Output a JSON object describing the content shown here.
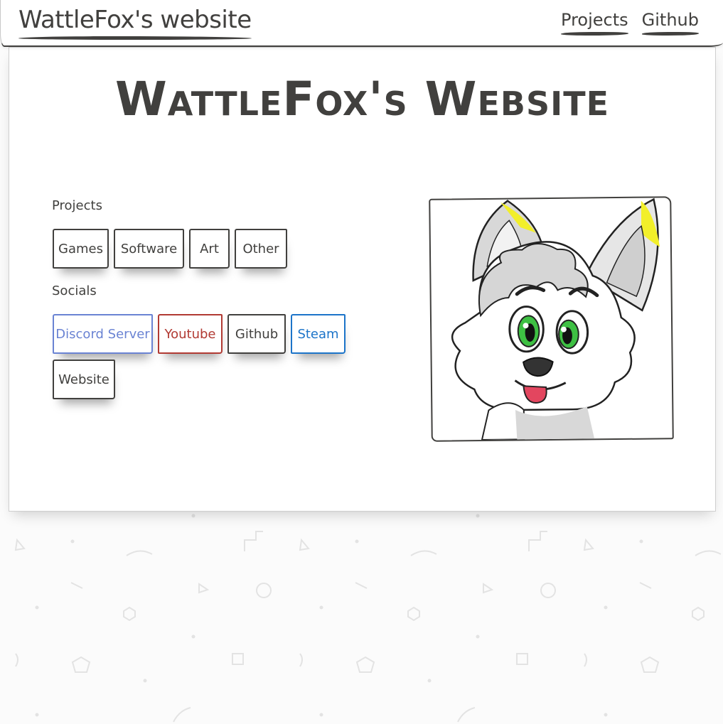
{
  "navbar": {
    "brand": "WattleFox's website",
    "links": [
      {
        "label": "Projects"
      },
      {
        "label": "Github"
      }
    ]
  },
  "main": {
    "title": "WattleFox's Website",
    "projects": {
      "label": "Projects",
      "buttons": [
        {
          "label": "Games"
        },
        {
          "label": "Software"
        },
        {
          "label": "Art"
        },
        {
          "label": "Other"
        }
      ]
    },
    "socials": {
      "label": "Socials",
      "buttons": [
        {
          "label": "Discord Server",
          "color": "#6a83d3"
        },
        {
          "label": "Youtube",
          "color": "#b13a33"
        },
        {
          "label": "Github",
          "color": "#41403e"
        },
        {
          "label": "Steam",
          "color": "#1c74c9"
        },
        {
          "label": "Website",
          "color": "#41403e"
        }
      ]
    },
    "avatar": {
      "icon": "fox-avatar-image"
    }
  },
  "colors": {
    "ink": "#41403e",
    "background": "#fbfbfb",
    "card": "#ffffff"
  }
}
